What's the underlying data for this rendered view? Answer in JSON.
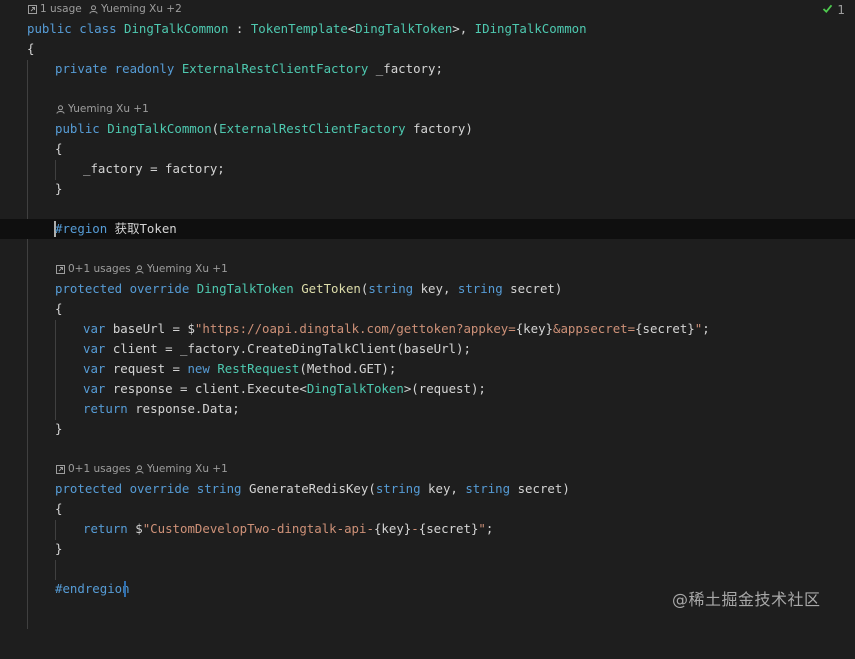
{
  "class_lens": {
    "usages": "1 usage",
    "author": "Yueming Xu +2"
  },
  "class_decl": {
    "public_kw": "public",
    "class_kw": "class",
    "name": "DingTalkCommon",
    "colon": " : ",
    "base": "TokenTemplate",
    "lt": "<",
    "generic": "DingTalkToken",
    "gt_comma": ">, ",
    "iface": "IDingTalkCommon"
  },
  "brace_open": "{",
  "brace_close": "}",
  "field_line": {
    "mods": "private readonly",
    "type": "ExternalRestClientFactory",
    "name": " _factory;"
  },
  "ctor_lens": {
    "author": "Yueming Xu +1"
  },
  "ctor_decl": {
    "kw": "public",
    "name": "DingTalkCommon",
    "paren_open": "(",
    "ptype": "ExternalRestClientFactory",
    "pname": " factory)"
  },
  "ctor_body": "_factory = factory;",
  "region": {
    "keyword": "#region",
    "label": " 获取Token"
  },
  "gettoken_lens": {
    "usages": "0+1 usages",
    "author": "Yueming Xu +1"
  },
  "gettoken_decl": {
    "mods": "protected override",
    "rtype": "DingTalkToken",
    "name": "GetToken",
    "paren_open": "(",
    "t1": "string",
    "p1": " key, ",
    "t2": "string",
    "p2": " secret)"
  },
  "gettoken_body": {
    "l1_var": "var",
    "l1_rest": " baseUrl = $",
    "l1_str1": "\"https://oapi.dingtalk.com/gettoken?appkey=",
    "l1_i1": "{key}",
    "l1_str2": "&appsecret=",
    "l1_i2": "{secret}",
    "l1_str3": "\"",
    "l1_end": ";",
    "l2_var": "var",
    "l2_rest": " client = _factory.",
    "l2_fn": "CreateDingTalkClient",
    "l2_end": "(baseUrl);",
    "l3_var": "var",
    "l3_rest": " request = ",
    "l3_new": "new",
    "l3_type": "RestRequest",
    "l3_end": "(Method.GET);",
    "l4_var": "var",
    "l4_rest": " response = client.",
    "l4_fn": "Execute",
    "l4_lt": "<",
    "l4_type": "DingTalkToken",
    "l4_end": ">(request);",
    "l5_ret": "return",
    "l5_rest": " response.Data;"
  },
  "redis_lens": {
    "usages": "0+1 usages",
    "author": "Yueming Xu +1"
  },
  "redis_decl": {
    "mods": "protected override",
    "rtype": "string",
    "name": "GenerateRedisKey",
    "paren_open": "(",
    "t1": "string",
    "p1": " key, ",
    "t2": "string",
    "p2": " secret)"
  },
  "redis_body": {
    "ret": "return",
    "dollar": " $",
    "str1": "\"CustomDevelopTwo-dingtalk-api-",
    "i1": "{key}",
    "dash": "-",
    "i2": "{secret}",
    "str2": "\"",
    "end": ";"
  },
  "endregion": "#endregion",
  "status": {
    "problems_count": "1"
  },
  "watermark": "@稀土掘金技术社区"
}
